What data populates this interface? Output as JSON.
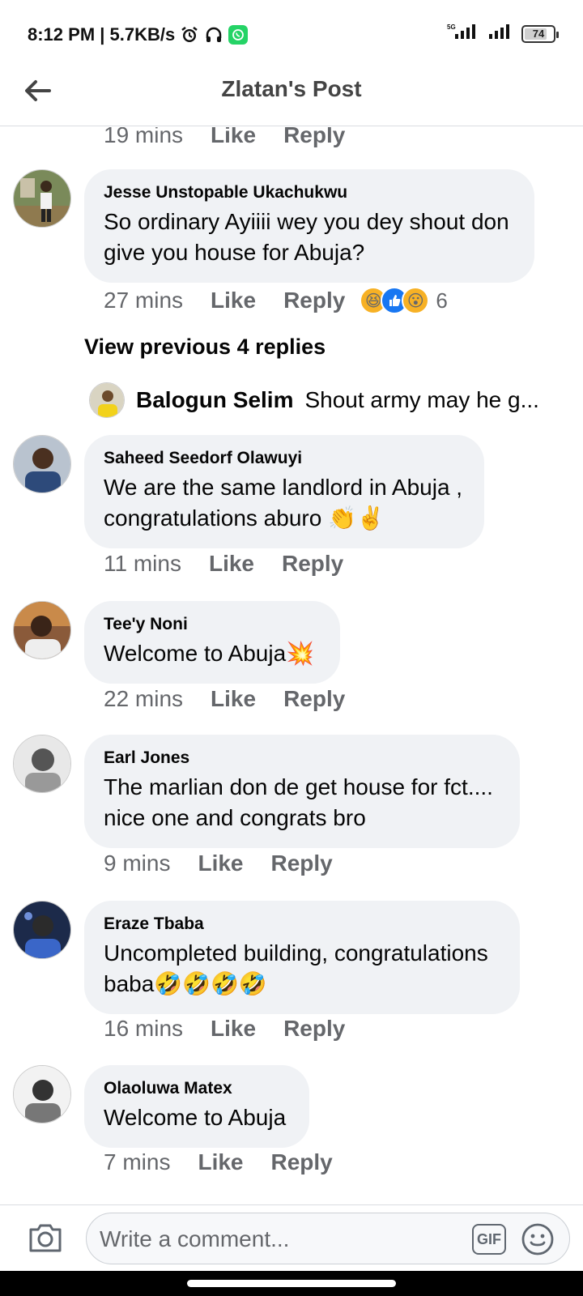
{
  "status": {
    "time_speed": "8:12 PM | 5.7KB/s",
    "network": "5G",
    "battery": "74"
  },
  "header": {
    "title": "Zlatan's Post"
  },
  "top_meta": {
    "time": "19 mins",
    "like": "Like",
    "reply": "Reply"
  },
  "comments": [
    {
      "author": "Jesse Unstopable Ukachukwu",
      "text_lines": [
        "So ordinary Ayiiii wey you dey shout don",
        "give you house for Abuja?"
      ],
      "time": "27 mins",
      "like": "Like",
      "reply": "Reply",
      "reaction_count": "6"
    },
    {
      "author": "Saheed Seedorf Olawuyi",
      "text_lines": [
        "We are the same landlord in Abuja ,",
        "congratulations aburo 👏✌️"
      ],
      "time": "11 mins",
      "like": "Like",
      "reply": "Reply"
    },
    {
      "author": "Tee'y Noni",
      "text_lines": [
        "Welcome to Abuja💥"
      ],
      "time": "22 mins",
      "like": "Like",
      "reply": "Reply"
    },
    {
      "author": "Earl Jones",
      "text_lines": [
        "The marlian don de get house for fct....",
        "nice one and congrats bro"
      ],
      "time": "9 mins",
      "like": "Like",
      "reply": "Reply"
    },
    {
      "author": "Eraze Tbaba",
      "text_lines": [
        "Uncompleted building, congratulations",
        "baba🤣🤣🤣🤣"
      ],
      "time": "16 mins",
      "like": "Like",
      "reply": "Reply"
    },
    {
      "author": "Olaoluwa Matex",
      "text_lines": [
        "Welcome to Abuja"
      ],
      "time": "7 mins",
      "like": "Like",
      "reply": "Reply"
    }
  ],
  "replies_thread": {
    "view_previous": "View previous 4 replies",
    "preview_author": "Balogun Selim",
    "preview_text": "Shout army may he g..."
  },
  "composer": {
    "placeholder": "Write a comment...",
    "gif_label": "GIF"
  },
  "colors": {
    "bubble": "#f0f2f5",
    "meta_text": "#65676b",
    "whatsapp": "#25d366"
  }
}
